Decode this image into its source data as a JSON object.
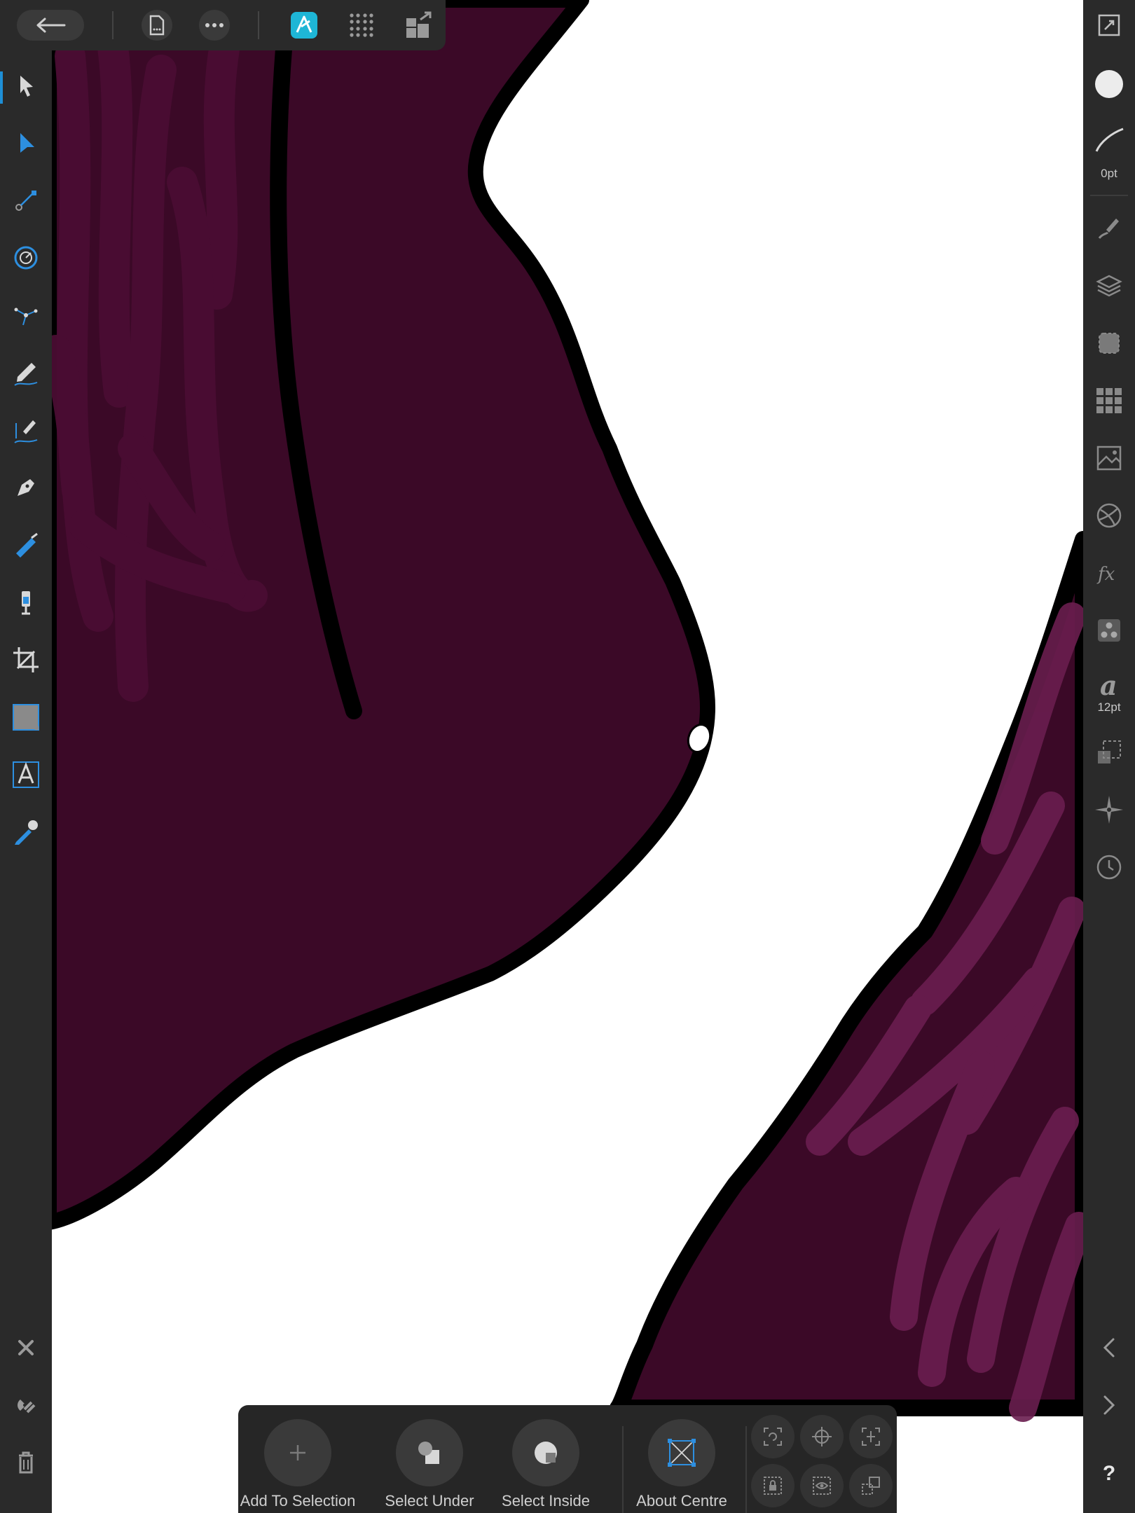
{
  "toolbar": {
    "back_icon": "arrow-left-icon",
    "document_icon": "document-icon",
    "more_icon": "more-dots-icon",
    "persona_icon": "designer-persona-icon",
    "grid_icon": "grid-dots-icon",
    "export_icon": "export-persona-icon",
    "accent": "#1eb6d6"
  },
  "tools": [
    {
      "name": "move-tool",
      "icon": "pointer-arrow-icon"
    },
    {
      "name": "node-tool",
      "icon": "node-arrow-icon"
    },
    {
      "name": "point-transform-tool",
      "icon": "point-transform-icon"
    },
    {
      "name": "corner-tool",
      "icon": "corner-target-icon"
    },
    {
      "name": "contour-tool",
      "icon": "contour-icon"
    },
    {
      "name": "pencil-tool",
      "icon": "pencil-icon"
    },
    {
      "name": "vector-brush-tool",
      "icon": "vector-brush-icon"
    },
    {
      "name": "pen-tool",
      "icon": "pen-nib-icon"
    },
    {
      "name": "fill-tool",
      "icon": "fill-bucket-icon"
    },
    {
      "name": "transparency-tool",
      "icon": "transparency-icon"
    },
    {
      "name": "crop-tool",
      "icon": "crop-icon"
    },
    {
      "name": "rectangle-tool",
      "icon": "rectangle-icon"
    },
    {
      "name": "artistic-text-tool",
      "icon": "text-a-icon"
    },
    {
      "name": "color-picker-tool",
      "icon": "eyedropper-icon"
    }
  ],
  "bottom_left_tools": {
    "close_icon": "close-icon",
    "snapping_icon": "magnet-icon",
    "delete_icon": "trash-icon"
  },
  "right_panel": {
    "stroke_width_label": "0pt",
    "font_size_label": "12pt",
    "help_label": "?",
    "icons": [
      "fullscreen-icon",
      "color-swatch-icon",
      "stroke-icon",
      "brushes-icon",
      "layers-icon",
      "appearance-icon",
      "swatches-icon",
      "assets-icon",
      "color-wheel-icon",
      "fx-icon",
      "styles-icon",
      "typography-icon",
      "transform-icon",
      "navigator-icon",
      "history-icon",
      "chevron-left-icon",
      "chevron-right-icon",
      "help-icon"
    ]
  },
  "context_bar": {
    "add_to_selection": "Add To Selection",
    "select_under": "Select Under",
    "select_inside": "Select Inside",
    "about_centre": "About Centre",
    "expand_icon": "play-triangle-icon"
  },
  "colors": {
    "dark_plum": "#3b0927",
    "mid_plum": "#4b0d34",
    "light_plum": "#6a1e4f",
    "outline": "#000000",
    "ui_dark": "#2a2a2a"
  }
}
